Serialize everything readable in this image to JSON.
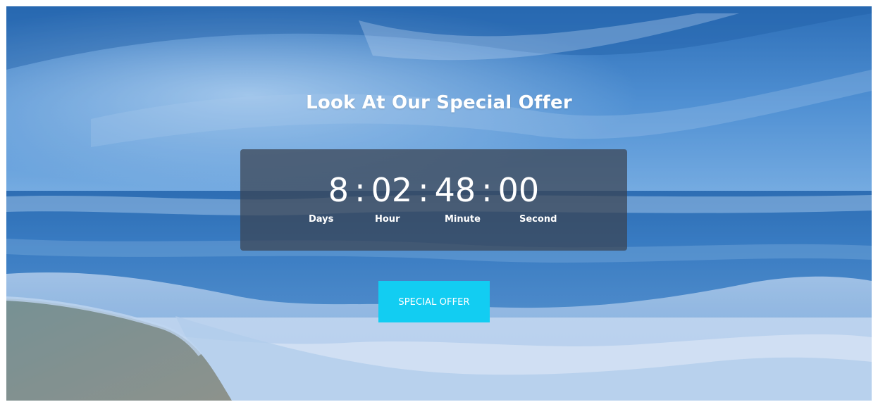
{
  "hero": {
    "title": "Look At Our Special Offer",
    "background": "beach-with-ocean-waves-and-sky"
  },
  "countdown": {
    "days": "8",
    "hours": "02",
    "minutes": "48",
    "seconds": "00",
    "separator": ":",
    "labels": {
      "days": "Days",
      "hours": "Hour",
      "minutes": "Minute",
      "seconds": "Second"
    }
  },
  "cta": {
    "label": "SPECIAL OFFER",
    "color": "#12cdf2"
  }
}
